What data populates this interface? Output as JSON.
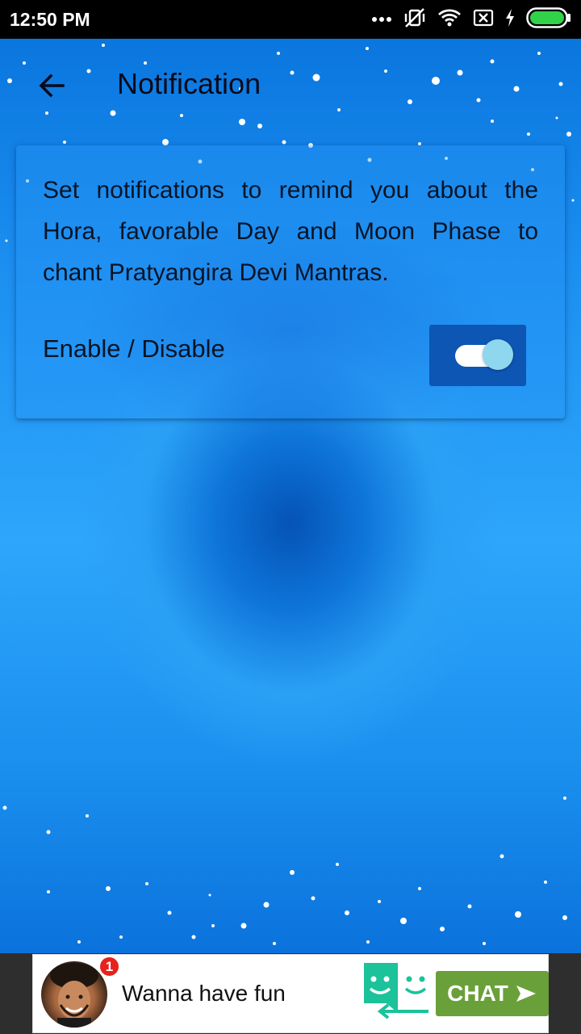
{
  "status_bar": {
    "time": "12:50 PM",
    "icons": [
      "more-dots-icon",
      "vibrate-off-icon",
      "wifi-icon",
      "sim-none-icon",
      "charging-icon",
      "battery-icon"
    ]
  },
  "app_bar": {
    "back_icon": "arrow-left-icon",
    "title": "Notification"
  },
  "card": {
    "description": "Set notifications to remind you about the Hora, favorable Day and Moon Phase to chant Pratyangira Devi Mantras.",
    "toggle_label": "Enable / Disable",
    "toggle_state": "on"
  },
  "ad": {
    "badge_count": "1",
    "text": "Wanna have fun",
    "cta_label": "CHAT",
    "cta_color": "#6aa03a",
    "logo_color": "#1bc29a"
  },
  "colors": {
    "background_blue": "#1c8ff0",
    "toggle_box": "#0d56b4",
    "toggle_knob": "#8fd6ef"
  }
}
